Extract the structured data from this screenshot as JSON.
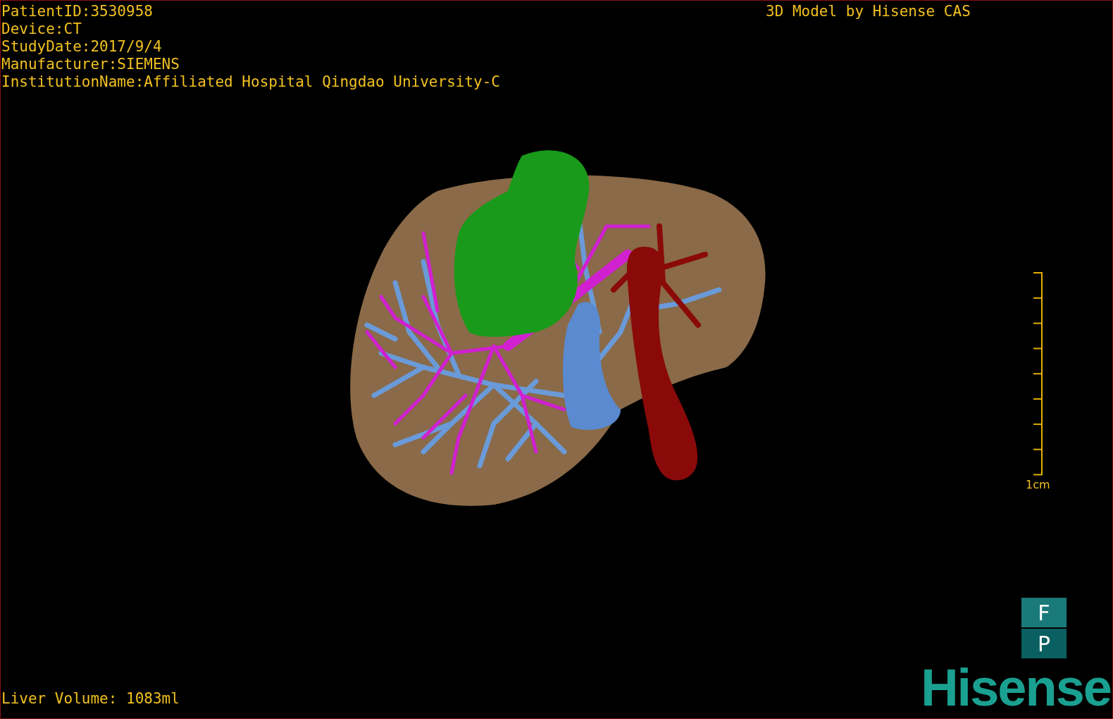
{
  "overlay": {
    "patient_info": [
      "PatientID:3530958",
      "Device:CT",
      "StudyDate:2017/9/4",
      "Manufacturer:SIEMENS",
      "InstitutionName:Affiliated Hospital Qingdao University-C"
    ],
    "model_credit": "3D Model by Hisense CAS",
    "scale_label": "1cm",
    "orientation_labels": [
      "F",
      "P"
    ],
    "liver_volume": "Liver Volume: 1083ml",
    "logo": "Hisense"
  }
}
